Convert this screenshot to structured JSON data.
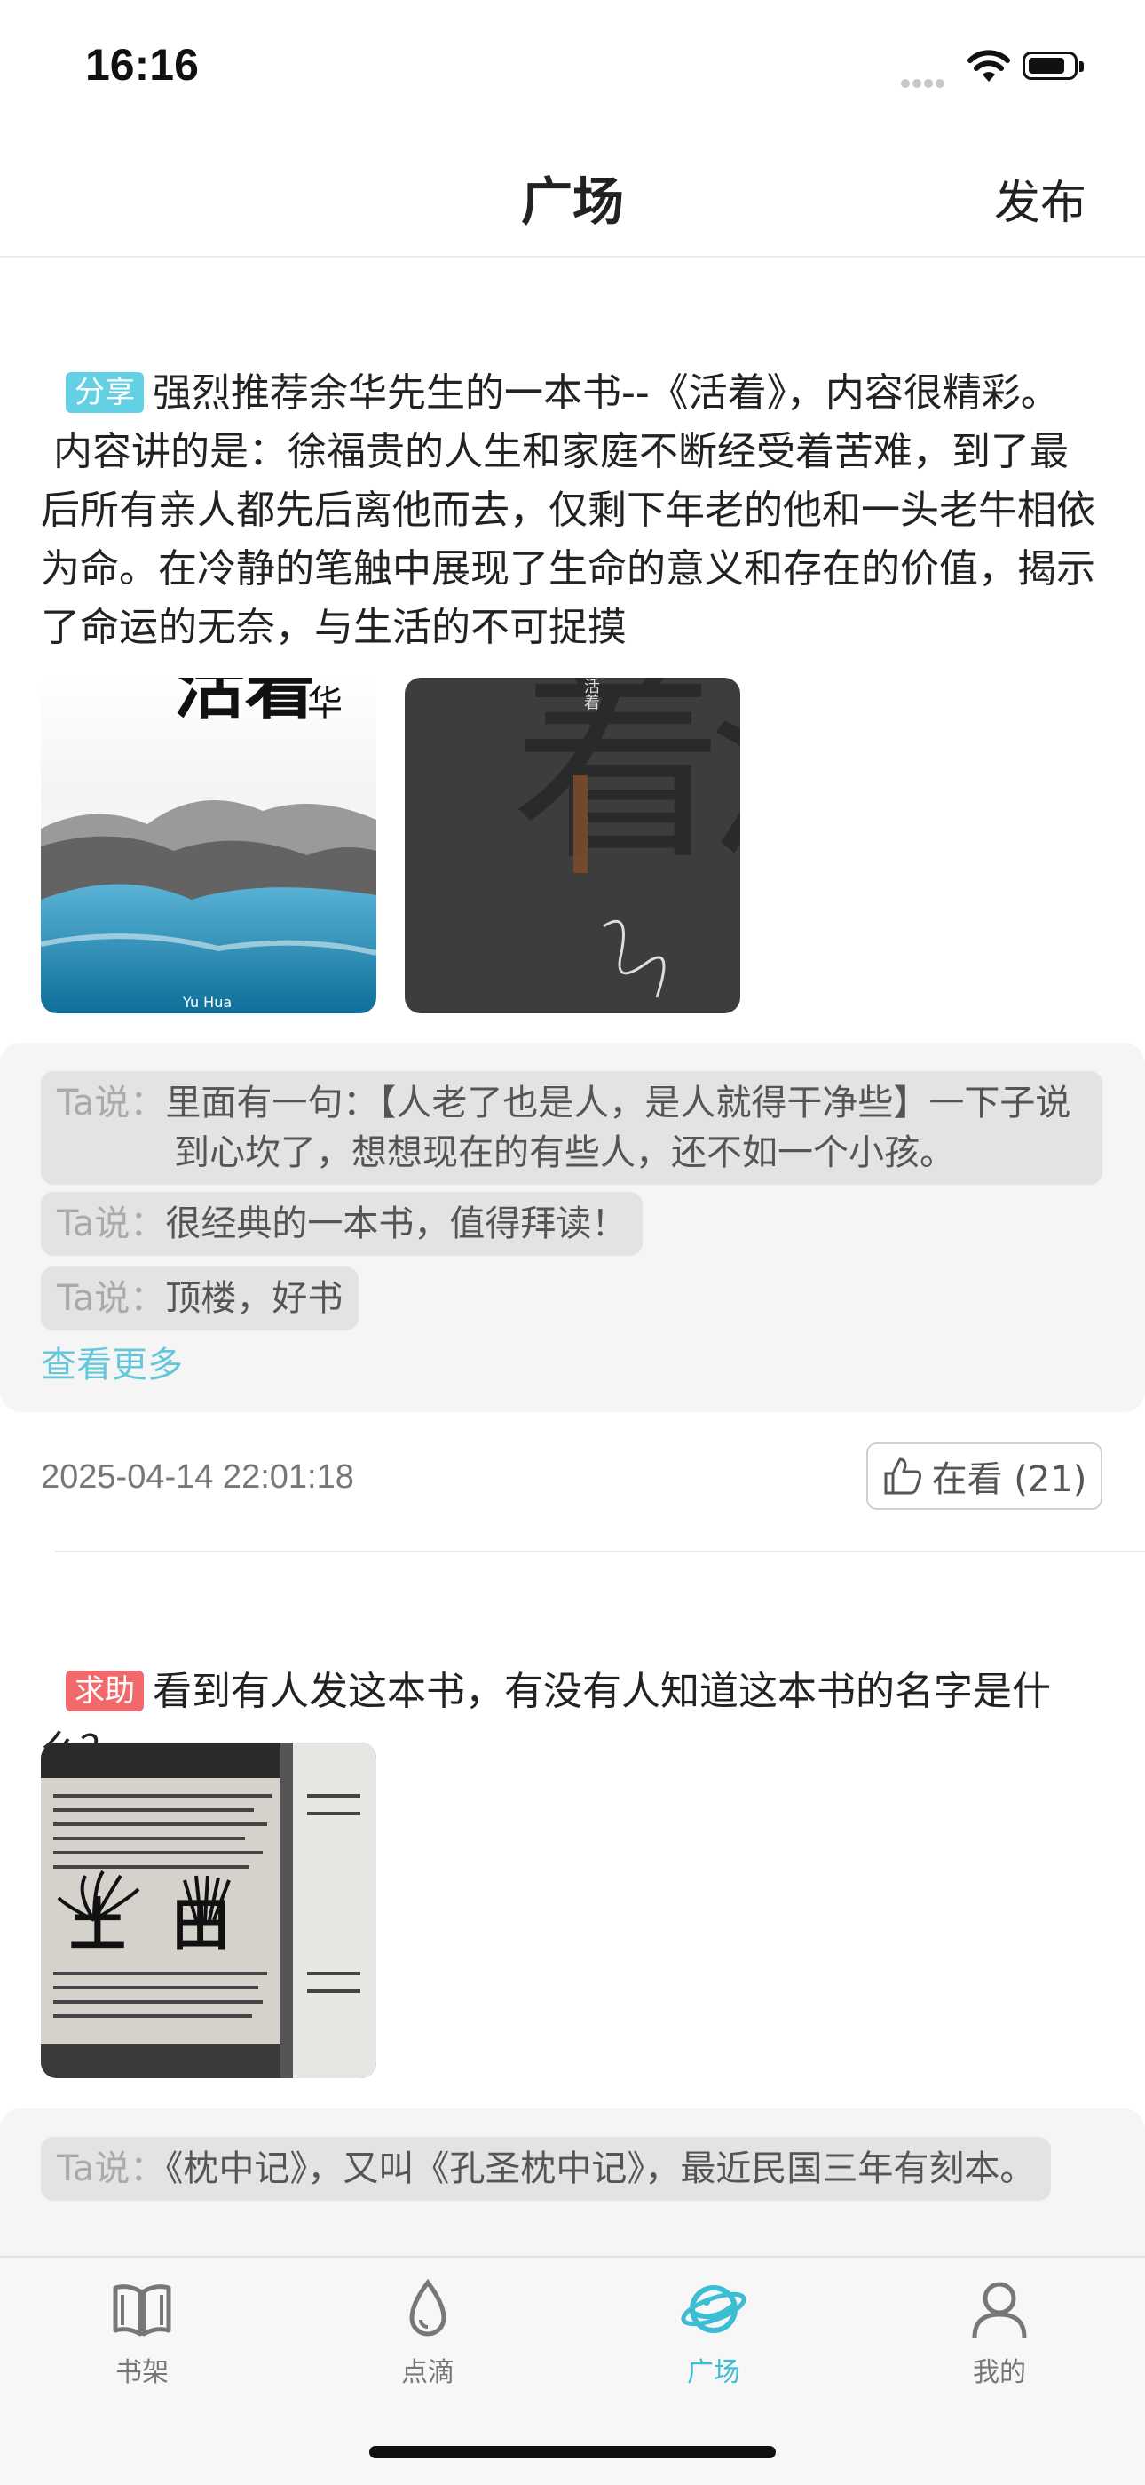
{
  "status_bar": {
    "time": "16:16"
  },
  "nav": {
    "title": "广场",
    "action": "发布"
  },
  "posts": [
    {
      "tag": "分享",
      "text": "强烈推荐余华先生的一本书--《活着》，内容很精彩。\n 内容讲的是：徐福贵的人生和家庭不断经受着苦难，到了最后所有亲人都先后离他而去，仅剩下年老的他和一头老牛相依为命。在冷静的笔触中展现了生命的意义和存在的价值，揭示了命运的无奈，与生活的不可捉摸",
      "images": [
        {
          "big_chars": "活着",
          "author_char": "华",
          "small_text": "Yu Hua"
        },
        {
          "big_chars": "活着",
          "small_title": "活着",
          "signature": "余华"
        }
      ],
      "comments": [
        {
          "who": "Ta说：",
          "text": "里面有一句：【人老了也是人，是人就得干净些】一下子说到心坎了，想想现在的有些人，还不如一个小孩。"
        },
        {
          "who": "Ta说：",
          "text": "很经典的一本书，值得拜读！"
        },
        {
          "who": "Ta说：",
          "text": "顶楼，好书"
        }
      ],
      "more": "查看更多",
      "date": "2025-04-14 22:01:18",
      "watch_label": "在看 (21)"
    },
    {
      "tag": "求助",
      "text": "看到有人发这本书，有没有人知道这本书的名字是什么？",
      "image_chars": [
        "土",
        "田"
      ],
      "comments": [
        {
          "who": "Ta说：",
          "text": "《枕中记》，又叫《孔圣枕中记》，最近民国三年有刻本。"
        }
      ]
    }
  ],
  "tabs": [
    {
      "label": "书架",
      "icon": "book-icon",
      "active": false
    },
    {
      "label": "点滴",
      "icon": "drop-icon",
      "active": false
    },
    {
      "label": "广场",
      "icon": "planet-icon",
      "active": true
    },
    {
      "label": "我的",
      "icon": "person-icon",
      "active": false
    }
  ],
  "colors": {
    "accent": "#3dbdd4",
    "share_tag": "#63d0e3",
    "help_tag": "#f1696a"
  }
}
